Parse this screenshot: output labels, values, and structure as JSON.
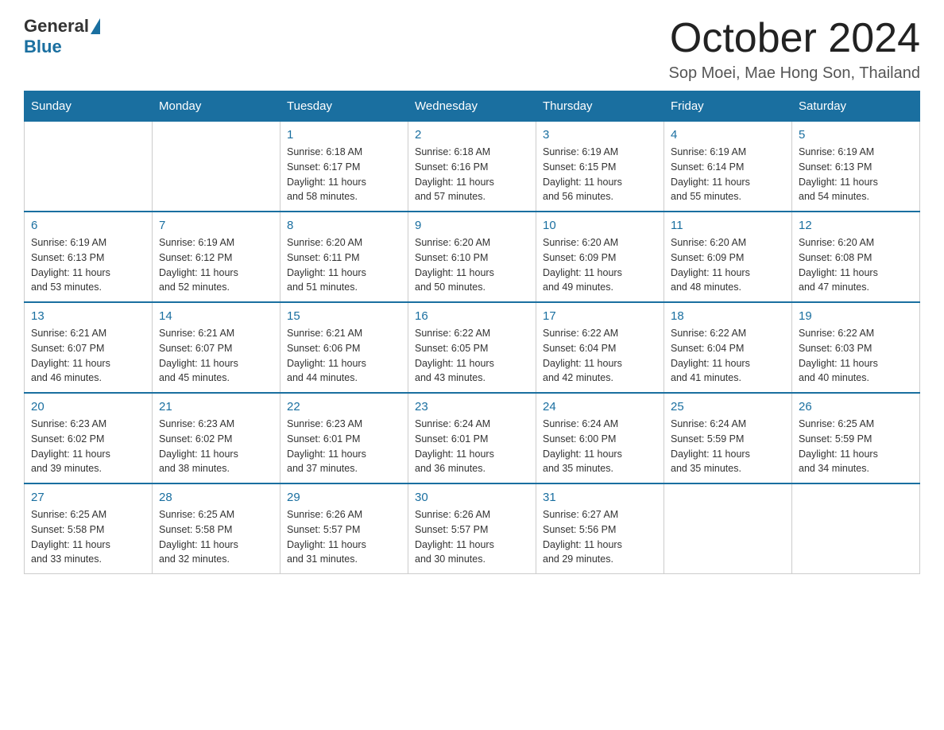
{
  "header": {
    "logo_general": "General",
    "logo_blue": "Blue",
    "title": "October 2024",
    "subtitle": "Sop Moei, Mae Hong Son, Thailand"
  },
  "weekdays": [
    "Sunday",
    "Monday",
    "Tuesday",
    "Wednesday",
    "Thursday",
    "Friday",
    "Saturday"
  ],
  "weeks": [
    [
      {
        "day": "",
        "info": ""
      },
      {
        "day": "",
        "info": ""
      },
      {
        "day": "1",
        "info": "Sunrise: 6:18 AM\nSunset: 6:17 PM\nDaylight: 11 hours\nand 58 minutes."
      },
      {
        "day": "2",
        "info": "Sunrise: 6:18 AM\nSunset: 6:16 PM\nDaylight: 11 hours\nand 57 minutes."
      },
      {
        "day": "3",
        "info": "Sunrise: 6:19 AM\nSunset: 6:15 PM\nDaylight: 11 hours\nand 56 minutes."
      },
      {
        "day": "4",
        "info": "Sunrise: 6:19 AM\nSunset: 6:14 PM\nDaylight: 11 hours\nand 55 minutes."
      },
      {
        "day": "5",
        "info": "Sunrise: 6:19 AM\nSunset: 6:13 PM\nDaylight: 11 hours\nand 54 minutes."
      }
    ],
    [
      {
        "day": "6",
        "info": "Sunrise: 6:19 AM\nSunset: 6:13 PM\nDaylight: 11 hours\nand 53 minutes."
      },
      {
        "day": "7",
        "info": "Sunrise: 6:19 AM\nSunset: 6:12 PM\nDaylight: 11 hours\nand 52 minutes."
      },
      {
        "day": "8",
        "info": "Sunrise: 6:20 AM\nSunset: 6:11 PM\nDaylight: 11 hours\nand 51 minutes."
      },
      {
        "day": "9",
        "info": "Sunrise: 6:20 AM\nSunset: 6:10 PM\nDaylight: 11 hours\nand 50 minutes."
      },
      {
        "day": "10",
        "info": "Sunrise: 6:20 AM\nSunset: 6:09 PM\nDaylight: 11 hours\nand 49 minutes."
      },
      {
        "day": "11",
        "info": "Sunrise: 6:20 AM\nSunset: 6:09 PM\nDaylight: 11 hours\nand 48 minutes."
      },
      {
        "day": "12",
        "info": "Sunrise: 6:20 AM\nSunset: 6:08 PM\nDaylight: 11 hours\nand 47 minutes."
      }
    ],
    [
      {
        "day": "13",
        "info": "Sunrise: 6:21 AM\nSunset: 6:07 PM\nDaylight: 11 hours\nand 46 minutes."
      },
      {
        "day": "14",
        "info": "Sunrise: 6:21 AM\nSunset: 6:07 PM\nDaylight: 11 hours\nand 45 minutes."
      },
      {
        "day": "15",
        "info": "Sunrise: 6:21 AM\nSunset: 6:06 PM\nDaylight: 11 hours\nand 44 minutes."
      },
      {
        "day": "16",
        "info": "Sunrise: 6:22 AM\nSunset: 6:05 PM\nDaylight: 11 hours\nand 43 minutes."
      },
      {
        "day": "17",
        "info": "Sunrise: 6:22 AM\nSunset: 6:04 PM\nDaylight: 11 hours\nand 42 minutes."
      },
      {
        "day": "18",
        "info": "Sunrise: 6:22 AM\nSunset: 6:04 PM\nDaylight: 11 hours\nand 41 minutes."
      },
      {
        "day": "19",
        "info": "Sunrise: 6:22 AM\nSunset: 6:03 PM\nDaylight: 11 hours\nand 40 minutes."
      }
    ],
    [
      {
        "day": "20",
        "info": "Sunrise: 6:23 AM\nSunset: 6:02 PM\nDaylight: 11 hours\nand 39 minutes."
      },
      {
        "day": "21",
        "info": "Sunrise: 6:23 AM\nSunset: 6:02 PM\nDaylight: 11 hours\nand 38 minutes."
      },
      {
        "day": "22",
        "info": "Sunrise: 6:23 AM\nSunset: 6:01 PM\nDaylight: 11 hours\nand 37 minutes."
      },
      {
        "day": "23",
        "info": "Sunrise: 6:24 AM\nSunset: 6:01 PM\nDaylight: 11 hours\nand 36 minutes."
      },
      {
        "day": "24",
        "info": "Sunrise: 6:24 AM\nSunset: 6:00 PM\nDaylight: 11 hours\nand 35 minutes."
      },
      {
        "day": "25",
        "info": "Sunrise: 6:24 AM\nSunset: 5:59 PM\nDaylight: 11 hours\nand 35 minutes."
      },
      {
        "day": "26",
        "info": "Sunrise: 6:25 AM\nSunset: 5:59 PM\nDaylight: 11 hours\nand 34 minutes."
      }
    ],
    [
      {
        "day": "27",
        "info": "Sunrise: 6:25 AM\nSunset: 5:58 PM\nDaylight: 11 hours\nand 33 minutes."
      },
      {
        "day": "28",
        "info": "Sunrise: 6:25 AM\nSunset: 5:58 PM\nDaylight: 11 hours\nand 32 minutes."
      },
      {
        "day": "29",
        "info": "Sunrise: 6:26 AM\nSunset: 5:57 PM\nDaylight: 11 hours\nand 31 minutes."
      },
      {
        "day": "30",
        "info": "Sunrise: 6:26 AM\nSunset: 5:57 PM\nDaylight: 11 hours\nand 30 minutes."
      },
      {
        "day": "31",
        "info": "Sunrise: 6:27 AM\nSunset: 5:56 PM\nDaylight: 11 hours\nand 29 minutes."
      },
      {
        "day": "",
        "info": ""
      },
      {
        "day": "",
        "info": ""
      }
    ]
  ]
}
